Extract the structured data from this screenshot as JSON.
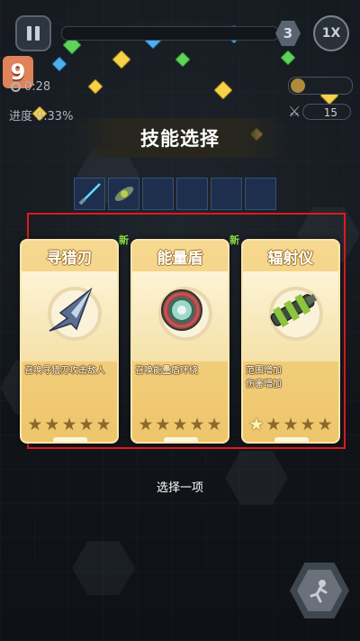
{
  "hud": {
    "level_number": "3",
    "speed_label": "1X",
    "wave_number": "9",
    "timer": "0:28",
    "progress_label": "进度 9.33%",
    "kills": "15"
  },
  "dialog": {
    "title": "技能选择",
    "prompt": "选择一项"
  },
  "cards": [
    {
      "name": "寻猎刃",
      "description": "召唤寻猎刃攻击敌人",
      "badge": "新",
      "stars_filled": 0,
      "stars_total": 5
    },
    {
      "name": "能量盾",
      "description": "召唤能量盾环绕",
      "badge": "新",
      "stars_filled": 0,
      "stars_total": 5
    },
    {
      "name": "辐射仪",
      "description": "范围增加\n伤害增加",
      "badge": "",
      "stars_filled": 1,
      "stars_total": 5
    }
  ],
  "skill_slots": {
    "filled": [
      "laser-sword-icon",
      "drone-icon"
    ],
    "total": 6
  },
  "colors": {
    "card_bg": "#f2cb74",
    "highlight_frame": "#e0191d",
    "new_badge": "#8de048",
    "slot_bg": "#1e2f4e"
  }
}
